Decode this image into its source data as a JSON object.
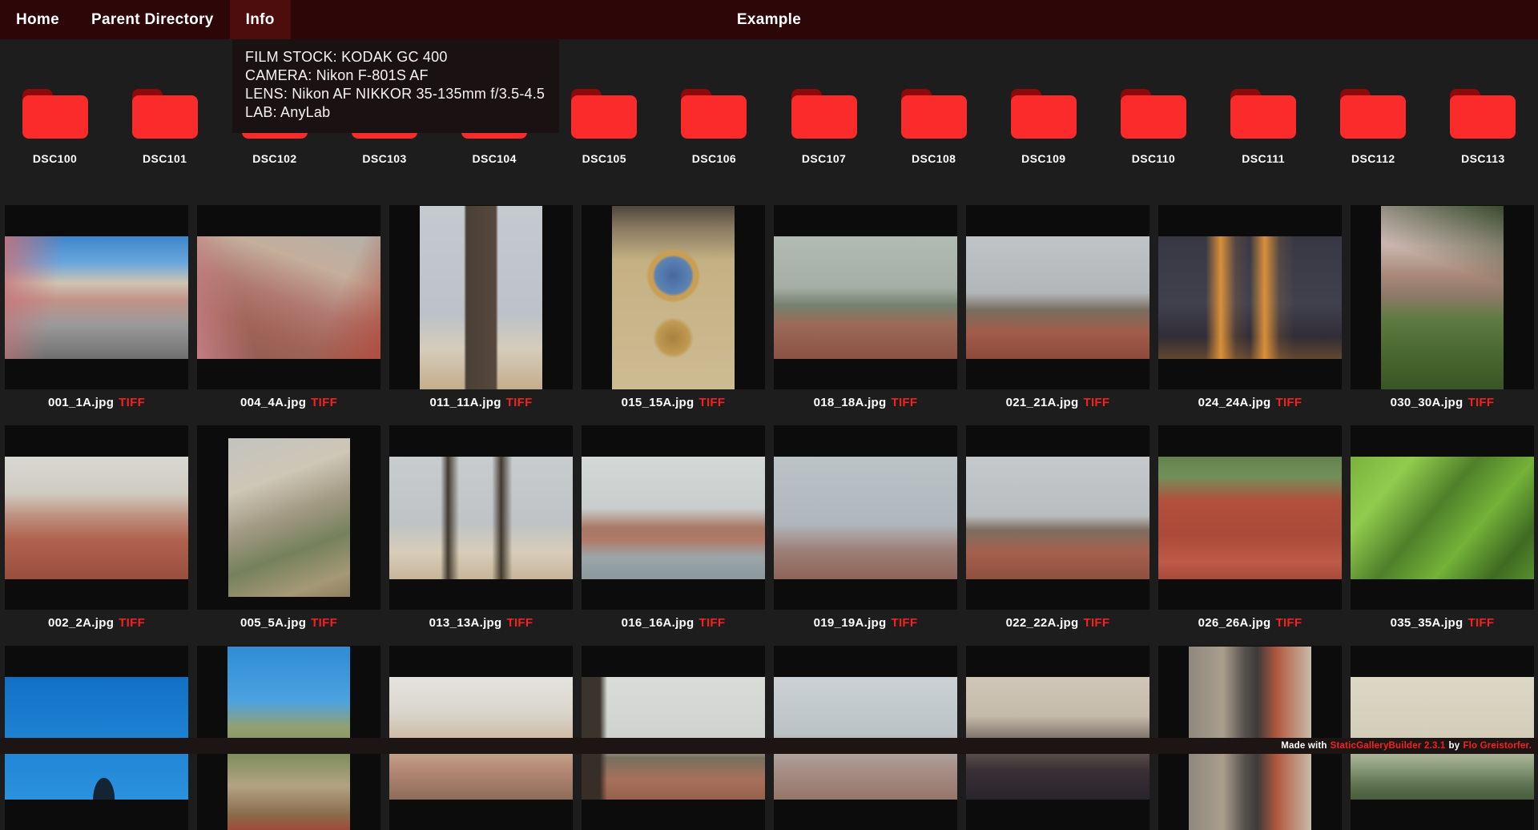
{
  "nav": {
    "items": [
      {
        "label": "Home",
        "active": false
      },
      {
        "label": "Parent Directory",
        "active": false
      },
      {
        "label": "Info",
        "active": true
      }
    ],
    "title": "Example"
  },
  "info": {
    "lines": [
      "FILM STOCK: KODAK GC 400",
      "CAMERA: Nikon F-801S AF",
      "LENS: Nikon AF NIKKOR 35-135mm f/3.5-4.5",
      "LAB: AnyLab"
    ]
  },
  "folders": [
    "DSC100",
    "DSC101",
    "DSC102",
    "DSC103",
    "DSC104",
    "DSC105",
    "DSC106",
    "DSC107",
    "DSC108",
    "DSC109",
    "DSC110",
    "DSC111",
    "DSC112",
    "DSC113"
  ],
  "gallery": {
    "rows": [
      {
        "items": [
          {
            "name": "001_1A.jpg",
            "format": "TIFF",
            "shape": "landscape",
            "bg": "linear-gradient(100deg, rgba(198,115,122,0.9) 0%, rgba(198,115,122,0) 30%), linear-gradient(180deg,#3c86cc 0%,#6ba6dc 22%,#cfc4b2 38%,#c19288 52%,#9a9a9a 72%,#707070 100%)"
          },
          {
            "name": "004_4A.jpg",
            "format": "TIFF",
            "shape": "landscape",
            "bg": "linear-gradient(75deg, rgba(205,130,140,0.85) 0%, rgba(205,130,140,0) 28%), linear-gradient(295deg, rgba(176,74,60,0.9) 0%, rgba(176,74,60,0) 30%), linear-gradient(200deg,#b4b0a8 0%,#c4ae9c 28%,#b07870 52%,#a06458 72%,#8e5a50 100%)"
          },
          {
            "name": "011_11A.jpg",
            "format": "TIFF",
            "shape": "portrait",
            "bg": "linear-gradient(90deg, rgba(0,0,0,0) 36%, #4a4036 38%, #56483c 62%, rgba(0,0,0,0) 64%), linear-gradient(180deg,#c5cacf 0%,#bcc2c8 60%,#d5ccba 78%,#c4ad8c 100%)"
          },
          {
            "name": "015_15A.jpg",
            "format": "TIFF",
            "shape": "portrait",
            "bg": "radial-gradient(circle at 50% 38%, #46699c 0%, #5d83b5 14%, #c89f55 16%, #c89f55 19%, rgba(0,0,0,0) 21%), radial-gradient(circle at 50% 72%, #a8813f 0%, #bf9a50 11%, rgba(0,0,0,0) 14%), linear-gradient(180deg,#4f463c 0%,#8a7a62 12%,#c4b183 30%,#cdbb92 100%)"
          },
          {
            "name": "018_18A.jpg",
            "format": "TIFF",
            "shape": "landscape",
            "bg": "linear-gradient(180deg,#b2bab4 0%,#a5aea6 42%,#76816f 56%,#9c6a58 72%,#8a5244 100%)"
          },
          {
            "name": "021_21A.jpg",
            "format": "TIFF",
            "shape": "landscape",
            "bg": "linear-gradient(180deg,#c0c4c6 0%,#b2b6b8 46%,#786e60 60%,#a25c4b 78%,#8c4a3c 100%)"
          },
          {
            "name": "024_24A.jpg",
            "format": "TIFF",
            "shape": "landscape",
            "bg": "linear-gradient(90deg, rgba(0,0,0,0) 26%, rgba(226,148,58,0.95) 34%, rgba(226,148,58,0.15) 42%, rgba(0,0,0,0) 50%, rgba(226,148,58,0.95) 58%, rgba(226,148,58,0.15) 66%, rgba(0,0,0,0) 74%), linear-gradient(0deg, rgba(160,110,60,0.5) 0%, rgba(0,0,0,0) 18%), linear-gradient(180deg,#383844 0%,#41414e 55%,#33303a 78%,#262229 100%)"
          },
          {
            "name": "030_30A.jpg",
            "format": "TIFF",
            "shape": "portrait",
            "bg": "linear-gradient(200deg, rgba(40,60,30,0.9) 0%, rgba(40,60,30,0) 35%), linear-gradient(180deg,#d3c3bd 0%,#c8b4ac 22%,#a88878 38%,#8f7a6a 48%,#5d7a42 62%,#48662f 82%,#3a5526 100%)"
          }
        ]
      },
      {
        "items": [
          {
            "name": "002_2A.jpg",
            "format": "TIFF",
            "shape": "landscape",
            "bg": "linear-gradient(180deg,#d8d8d4 0%,#cfcbc0 30%,#bd9180 48%,#b0624e 68%,#994e3e 100%)"
          },
          {
            "name": "005_5A.jpg",
            "format": "TIFF",
            "shape": "portrait-short",
            "bg": "linear-gradient(160deg,#c2c4bf 0%,#cec6b6 28%,#a39a85 48%,#75815c 68%,#a59877 88%,#8f7e5e 100%)"
          },
          {
            "name": "013_13A.jpg",
            "format": "TIFF",
            "shape": "landscape",
            "bg": "linear-gradient(90deg, rgba(0,0,0,0) 28%, rgba(58,50,40,0.95) 32%, rgba(58,50,40,0) 38%, rgba(0,0,0,0) 56%, rgba(58,50,40,0.95) 61%, rgba(58,50,40,0) 67%), linear-gradient(180deg,#c8cccd 0%,#bfc3c5 55%,#d8cdb9 78%,#c7b59a 100%)"
          },
          {
            "name": "016_16A.jpg",
            "format": "TIFF",
            "shape": "landscape",
            "bg": "linear-gradient(180deg,#d4d8d6 0%,#c9cdcb 42%,#a87866 58%,#b07a68 68%,#9aa6a8 82%,#8b989c 100%)"
          },
          {
            "name": "019_19A.jpg",
            "format": "TIFF",
            "shape": "landscape",
            "bg": "linear-gradient(180deg,#bcc3c7 0%,#b0b7bc 55%,#9d8078 76%,#8f6458 100%)"
          },
          {
            "name": "022_22A.jpg",
            "format": "TIFF",
            "shape": "landscape",
            "bg": "linear-gradient(180deg,#c5c9cb 0%,#babdbf 48%,#7c6e60 60%,#a6604e 78%,#8f5040 100%)"
          },
          {
            "name": "026_26A.jpg",
            "format": "TIFF",
            "shape": "landscape",
            "bg": "linear-gradient(180deg,#64824e 0%,#70905a 16%,#b2503c 36%,#aa4a38 64%,#bf5a48 86%,#a84a3a 100%)"
          },
          {
            "name": "035_35A.jpg",
            "format": "TIFF",
            "shape": "landscape",
            "bg": "linear-gradient(130deg,#7ab23d 0%,#92cc4e 22%,#4f7f2a 45%,#74b239 65%,#3f6a22 85%,#578f2e 100%)"
          }
        ]
      },
      {
        "items": [
          {
            "name": "",
            "format": "",
            "shape": "landscape",
            "bg": "radial-gradient(ellipse 10% 30% at 54% 100%, #142434 58%, rgba(0,0,0,0) 60%), linear-gradient(180deg,#1270c4 0%,#1f84d4 55%,#2b92de 100%)"
          },
          {
            "name": "",
            "format": "",
            "shape": "portrait",
            "bg": "linear-gradient(180deg,#2f8cd4 0%,#4da2de 30%,#93a070 44%,#7d8c5c 58%,#b2a383 76%,#8a6a4c 92%,#a04a3a 100%)"
          },
          {
            "name": "",
            "format": "",
            "shape": "landscape",
            "bg": "linear-gradient(180deg,#e4e3df 0%,#dad6cd 28%,#ccb9a3 52%,#b68a76 74%,#8d6c5a 100%)"
          },
          {
            "name": "",
            "format": "",
            "shape": "landscape",
            "bg": "linear-gradient(90deg, rgba(50,43,36,0.95) 0%, rgba(50,43,36,0.95) 10%, rgba(50,43,36,0) 14%), linear-gradient(180deg,#dadcd8 0%,#ced2ce 52%,#77705f 66%,#a8705c 84%,#95614c 100%)"
          },
          {
            "name": "",
            "format": "",
            "shape": "landscape",
            "bg": "linear-gradient(180deg,#cbd1d4 0%,#bcc3c7 45%,#a8938b 72%,#97756a 100%)"
          },
          {
            "name": "",
            "format": "",
            "shape": "landscape",
            "bg": "linear-gradient(180deg,#d0c7b9 0%,#c4baa9 32%,#695c55 56%,#383034 76%,#2a242c 100%)"
          },
          {
            "name": "",
            "format": "",
            "shape": "portrait",
            "bg": "linear-gradient(90deg,#8e897e 0%,#aa9d8c 28%,#55504c 46%,#3e3a38 56%,#b25940 72%,#c9bbaa 100%)"
          },
          {
            "name": "",
            "format": "",
            "shape": "landscape",
            "bg": "linear-gradient(180deg,#dcd8c6 0%,#d2cdb8 52%,#90a07e 72%,#5e7350 88%,#495c3e 100%)"
          }
        ]
      }
    ]
  },
  "footer": {
    "made_with": "Made with",
    "builder_link": "StaticGalleryBuilder 2.3.1",
    "by": "by",
    "author_link": "Flo Greistorfer."
  },
  "colors": {
    "page_bg": "#1d1d1d",
    "nav_bg": "#2d0708",
    "nav_active": "#4e0d0d",
    "info_bg": "#1a1113",
    "cell_bg": "#0c0c0c",
    "accent": "#f12222",
    "folder_red": "#fb2b2b",
    "folder_tab": "#8e0909",
    "footer_bg": "#1d1414"
  }
}
